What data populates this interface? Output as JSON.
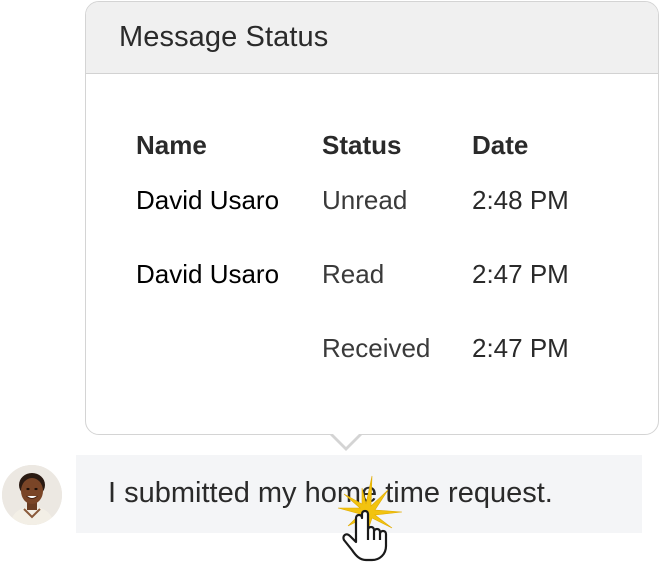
{
  "popover": {
    "title": "Message Status",
    "columns": {
      "name": "Name",
      "status": "Status",
      "date": "Date"
    },
    "rows": [
      {
        "name": "David Usaro",
        "status": "Unread",
        "date": "2:48 PM"
      },
      {
        "name": "David Usaro",
        "status": "Read",
        "date": "2:47 PM"
      },
      {
        "name": "",
        "status": "Received",
        "date": "2:47 PM"
      }
    ]
  },
  "message": {
    "text": "I submitted my home time request."
  },
  "icons": {
    "avatar": "user-avatar",
    "cursor": "hand-pointer-click-icon"
  },
  "colors": {
    "header_bg": "#f0f0f0",
    "bubble_bg": "#f4f5f7",
    "click_burst": "#f2c30f"
  }
}
